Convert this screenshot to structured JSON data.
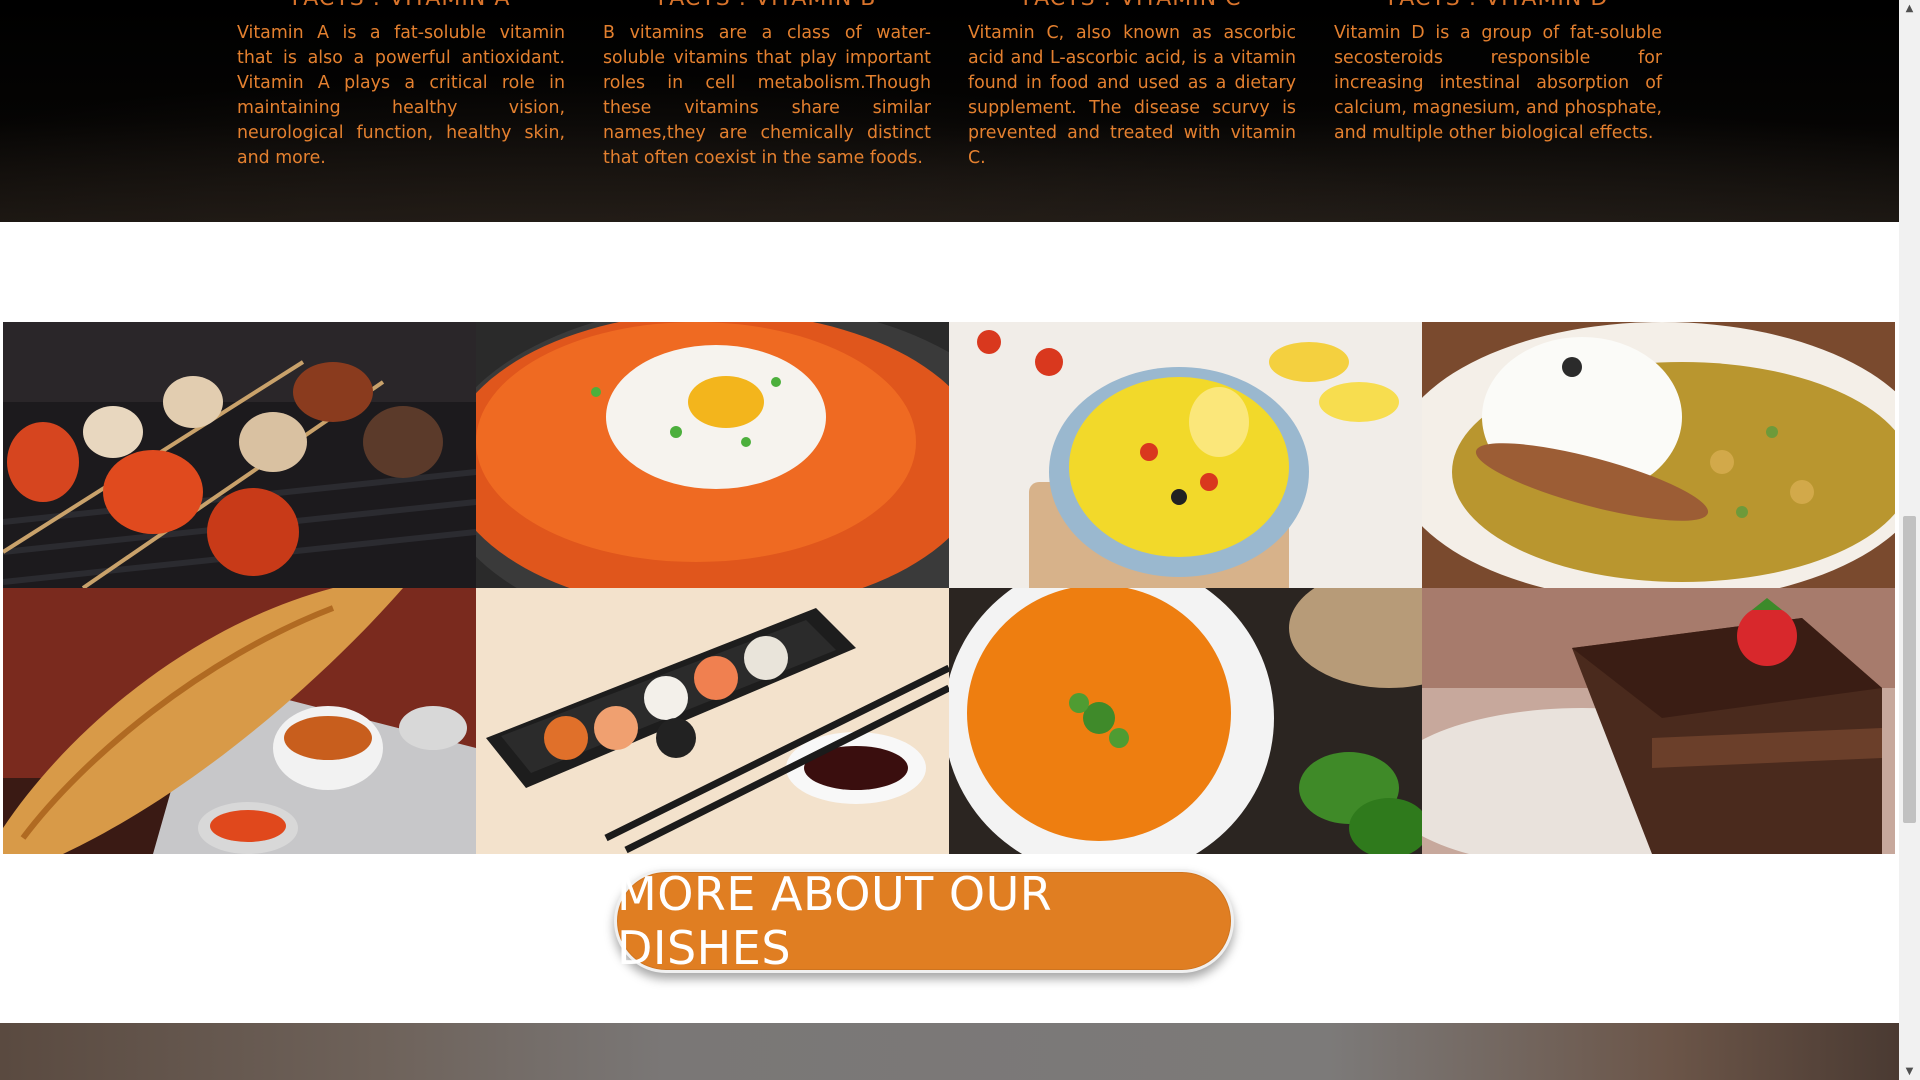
{
  "facts": [
    {
      "title": "FACTS : VITAMIN A",
      "text": "Vitamin A is a fat-soluble vitamin that is also a powerful antioxidant. Vitamin A plays a critical role in maintaining healthy vision, neurological function, healthy skin, and more."
    },
    {
      "title": "FACTS : VITAMIN B",
      "text": "B vitamins are a class of water-soluble vitamins that play important roles in cell metabolism.Though these vitamins share similar names,they are chemically distinct that often coexist in the same foods."
    },
    {
      "title": "FACTS : VITAMIN C",
      "text": "Vitamin C, also known as ascorbic acid and L-ascorbic acid, is a vitamin found in food and used as a dietary supplement. The disease scurvy is prevented and treated with vitamin C."
    },
    {
      "title": "FACTS : VITAMIN D",
      "text": "Vitamin D is a group of fat-soluble secosteroids responsible for increasing intestinal absorption of calcium, magnesium, and phosphate, and multiple other biological effects."
    }
  ],
  "gallery": [
    {
      "dish": "grilled-skewers"
    },
    {
      "dish": "kimchi-fried-rice-egg"
    },
    {
      "dish": "yellow-rice-bowl"
    },
    {
      "dish": "curry-rice"
    },
    {
      "dish": "masala-dosa"
    },
    {
      "dish": "sushi-box"
    },
    {
      "dish": "pumpkin-soup"
    },
    {
      "dish": "chocolate-cake"
    }
  ],
  "cta": {
    "label": "MORE ABOUT OUR DISHES"
  },
  "colors": {
    "accent": "#e07e22",
    "fact_text": "#e4802f",
    "band_bg": "#000000"
  }
}
